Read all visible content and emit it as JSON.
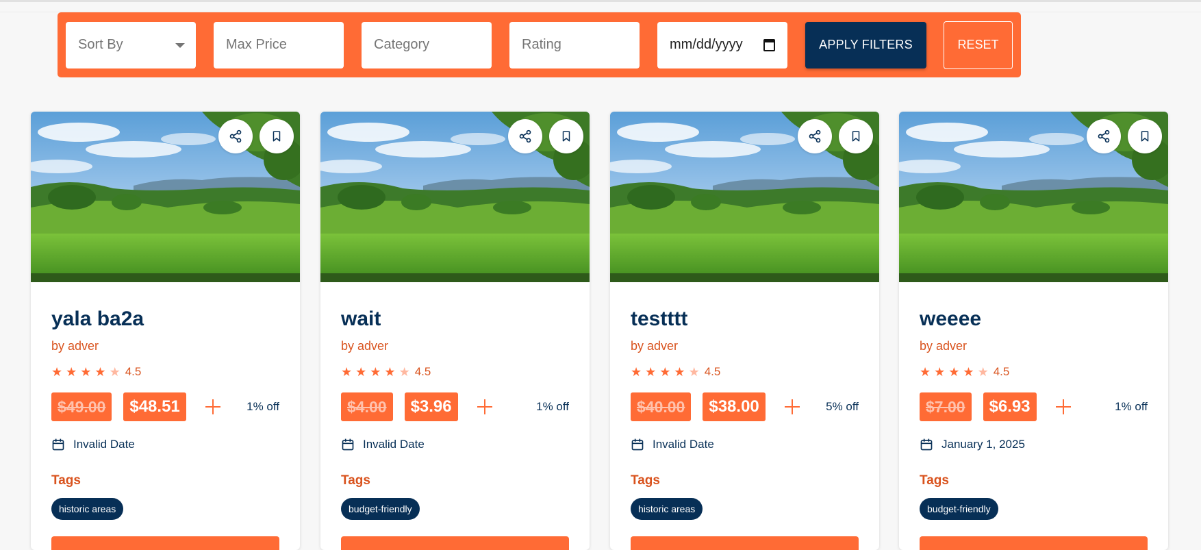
{
  "filters": {
    "sort_label": "Sort By",
    "max_price_placeholder": "Max Price",
    "category_placeholder": "Category",
    "rating_placeholder": "Rating",
    "date_placeholder": "mm/dd/yyyy",
    "apply_label": "APPLY FILTERS",
    "reset_label": "RESET"
  },
  "colors": {
    "accent": "#ff6b35",
    "navy": "#072f56",
    "author": "#d9531e"
  },
  "icons": [
    "share-icon",
    "bookmark-icon",
    "calendar-icon",
    "plus-icon",
    "star-icon",
    "chevron-down-icon"
  ],
  "cards": [
    {
      "title": "yala ba2a",
      "author": "by adver",
      "rating": "4.5",
      "rating_value": 4.5,
      "old_price": "$49.00",
      "new_price": "$48.51",
      "discount": "1% off",
      "date": "Invalid Date",
      "tags_heading": "Tags",
      "tags": [
        "historic areas"
      ]
    },
    {
      "title": "wait",
      "author": "by adver",
      "rating": "4.5",
      "rating_value": 4.5,
      "old_price": "$4.00",
      "new_price": "$3.96",
      "discount": "1% off",
      "date": "Invalid Date",
      "tags_heading": "Tags",
      "tags": [
        "budget-friendly"
      ]
    },
    {
      "title": "testttt",
      "author": "by adver",
      "rating": "4.5",
      "rating_value": 4.5,
      "old_price": "$40.00",
      "new_price": "$38.00",
      "discount": "5% off",
      "date": "Invalid Date",
      "tags_heading": "Tags",
      "tags": [
        "historic areas"
      ]
    },
    {
      "title": "weeee",
      "author": "by adver",
      "rating": "4.5",
      "rating_value": 4.5,
      "old_price": "$7.00",
      "new_price": "$6.93",
      "discount": "1% off",
      "date": "January 1, 2025",
      "tags_heading": "Tags",
      "tags": [
        "budget-friendly"
      ]
    }
  ]
}
